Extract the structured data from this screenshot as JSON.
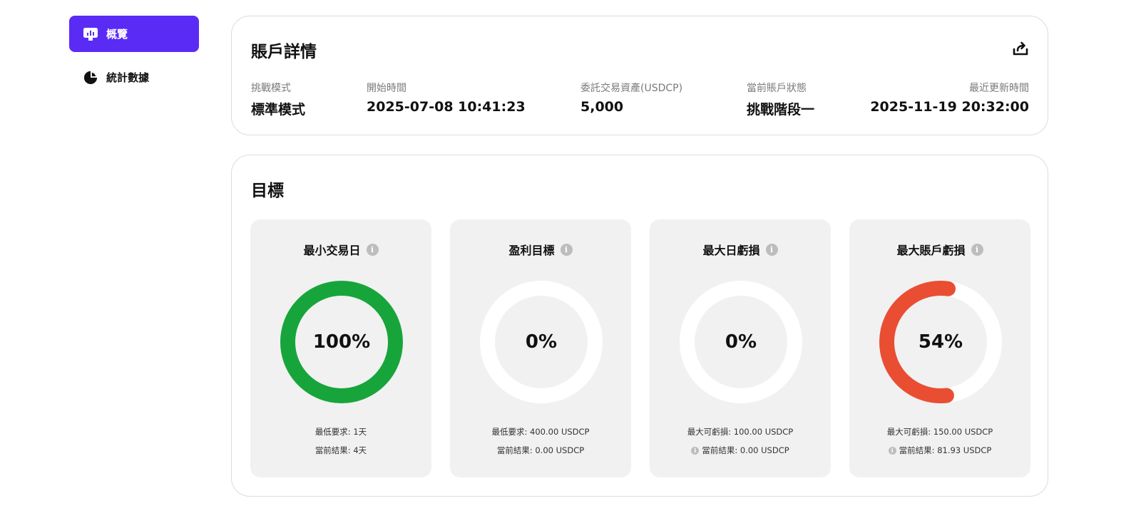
{
  "sidebar": {
    "items": [
      {
        "label": "概覽",
        "icon": "overview-icon",
        "active": true
      },
      {
        "label": "統計數據",
        "icon": "pie-chart-icon",
        "active": false
      }
    ]
  },
  "account": {
    "title": "賬戶詳情",
    "fields": [
      {
        "label": "挑戰模式",
        "value": "標準模式"
      },
      {
        "label": "開始時間",
        "value": "2025-07-08 10:41:23"
      },
      {
        "label": "委託交易資產(USDCP)",
        "value": "5,000"
      },
      {
        "label": "當前賬戶狀態",
        "value": "挑戰階段一"
      },
      {
        "label": "最近更新時間",
        "value": "2025-11-19 20:32:00"
      }
    ]
  },
  "goals": {
    "title": "目標",
    "items": [
      {
        "title": "最小交易日",
        "percent": 100,
        "percent_text": "100%",
        "color": "#17a53b",
        "line1": "最低要求: 1天",
        "line2": "當前結果: 4天",
        "line2_info": false
      },
      {
        "title": "盈利目標",
        "percent": 0,
        "percent_text": "0%",
        "color": "#17a53b",
        "line1": "最低要求: 400.00 USDCP",
        "line2": "當前結果: 0.00 USDCP",
        "line2_info": false
      },
      {
        "title": "最大日虧損",
        "percent": 0,
        "percent_text": "0%",
        "color": "#e94e33",
        "line1": "最大可虧損: 100.00 USDCP",
        "line2": "當前結果: 0.00 USDCP",
        "line2_info": true
      },
      {
        "title": "最大賬戶虧損",
        "percent": 54,
        "percent_text": "54%",
        "color": "#e94e33",
        "line1": "最大可虧損: 150.00 USDCP",
        "line2": "當前結果: 81.93 USDCP",
        "line2_info": true
      }
    ]
  },
  "colors": {
    "accent": "#5b2bf6",
    "success": "#17a53b",
    "danger": "#e94e33"
  }
}
